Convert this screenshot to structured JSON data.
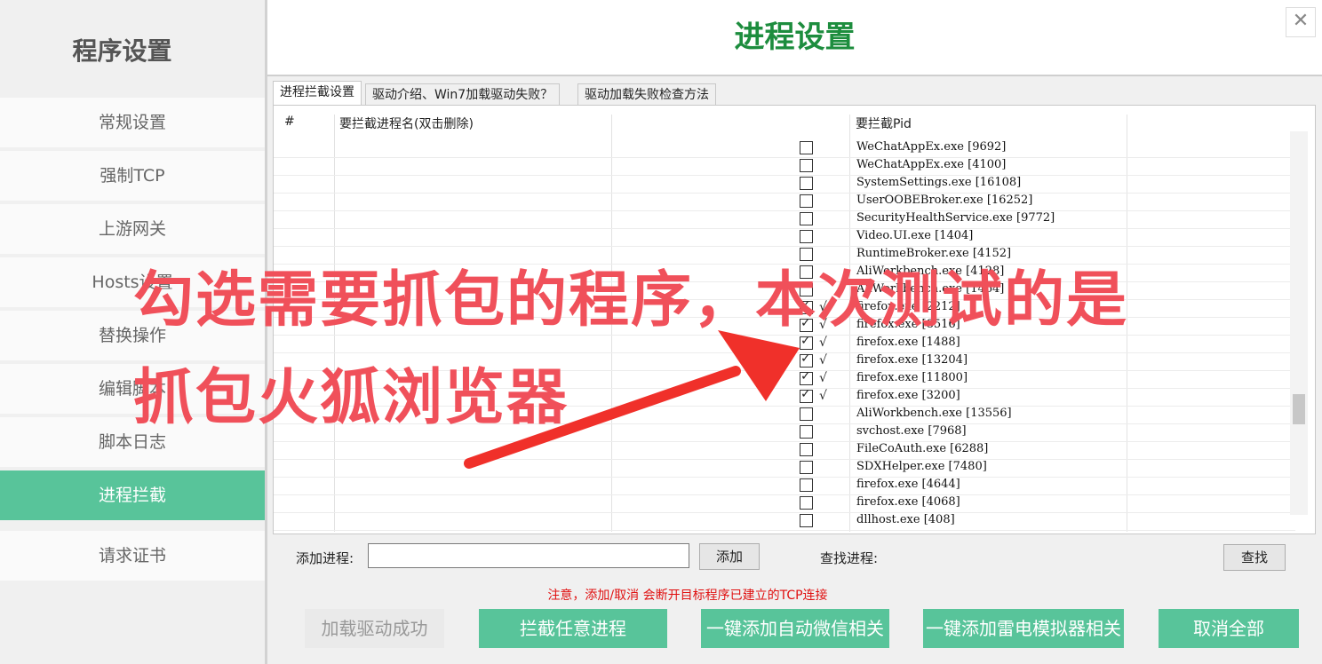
{
  "sidebar": {
    "title": "程序设置",
    "items": [
      {
        "label": "常规设置",
        "active": false
      },
      {
        "label": "强制TCP",
        "active": false
      },
      {
        "label": "上游网关",
        "active": false
      },
      {
        "label": "Hosts设置",
        "active": false
      },
      {
        "label": "替换操作",
        "active": false
      },
      {
        "label": "编辑脚本",
        "active": false
      },
      {
        "label": "脚本日志",
        "active": false
      },
      {
        "label": "进程拦截",
        "active": true
      },
      {
        "label": "请求证书",
        "active": false
      }
    ]
  },
  "header": {
    "title": "进程设置",
    "close_icon": "✕"
  },
  "tabs": [
    "进程拦截设置",
    "驱动介绍、Win7加载驱动失败？",
    "驱动加载失败检查方法"
  ],
  "table": {
    "headers": [
      "#",
      "要拦截进程名(双击删除)",
      "要拦截Pid"
    ],
    "processes": [
      {
        "name": "WeChatAppEx.exe [9692]",
        "checked": false
      },
      {
        "name": "WeChatAppEx.exe [4100]",
        "checked": false
      },
      {
        "name": "SystemSettings.exe [16108]",
        "checked": false
      },
      {
        "name": "UserOOBEBroker.exe [16252]",
        "checked": false
      },
      {
        "name": "SecurityHealthService.exe [9772]",
        "checked": false
      },
      {
        "name": "Video.UI.exe [1404]",
        "checked": false
      },
      {
        "name": "RuntimeBroker.exe [4152]",
        "checked": false
      },
      {
        "name": "AliWorkbench.exe [4128]",
        "checked": false
      },
      {
        "name": "AliWorkbench.exe [1464]",
        "checked": false
      },
      {
        "name": "firefox.exe [2212]",
        "checked": true
      },
      {
        "name": "firefox.exe [8516]",
        "checked": true
      },
      {
        "name": "firefox.exe [1488]",
        "checked": true
      },
      {
        "name": "firefox.exe [13204]",
        "checked": true
      },
      {
        "name": "firefox.exe [11800]",
        "checked": true
      },
      {
        "name": "firefox.exe [3200]",
        "checked": true
      },
      {
        "name": "AliWorkbench.exe [13556]",
        "checked": false
      },
      {
        "name": "svchost.exe [7968]",
        "checked": false
      },
      {
        "name": "FileCoAuth.exe [6288]",
        "checked": false
      },
      {
        "name": "SDXHelper.exe [7480]",
        "checked": false
      },
      {
        "name": "firefox.exe [4644]",
        "checked": false
      },
      {
        "name": "firefox.exe [4068]",
        "checked": false
      },
      {
        "name": "dllhost.exe [408]",
        "checked": false
      }
    ],
    "tick_mark": "√"
  },
  "controls": {
    "add_label": "添加进程:",
    "add_input_value": "",
    "add_button": "添加",
    "find_label": "查找进程:",
    "find_button": "查找"
  },
  "notice": "注意，添加/取消 会断开目标程序已建立的TCP连接",
  "bottom_buttons": [
    {
      "label": "加载驱动成功",
      "enabled": false
    },
    {
      "label": "拦截任意进程",
      "enabled": true
    },
    {
      "label": "一键添加自动微信相关",
      "enabled": true
    },
    {
      "label": "一键添加雷电模拟器相关",
      "enabled": true
    },
    {
      "label": "取消全部",
      "enabled": true
    }
  ],
  "annotation": {
    "line1": "勾选需要抓包的程序，本次测试的是",
    "line2": "抓包火狐浏览器",
    "color": "#f0505a"
  },
  "colors": {
    "accent": "#58c49a",
    "title_green": "#1d8d3e",
    "notice_red": "#e01010"
  }
}
